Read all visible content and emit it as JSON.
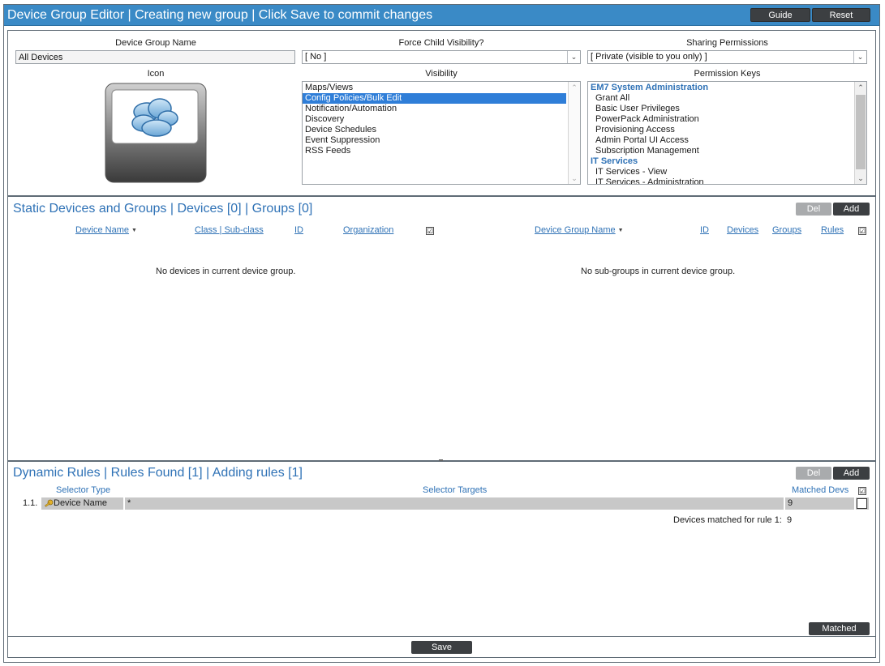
{
  "window": {
    "title": "Device Group Editor | Creating new group | Click Save to commit changes",
    "guide_label": "Guide",
    "reset_label": "Reset"
  },
  "top": {
    "name_label": "Device Group Name",
    "name_value": "All Devices",
    "force_label": "Force Child Visibility?",
    "force_value": "[ No ]",
    "sharing_label": "Sharing Permissions",
    "sharing_value": "[ Private (visible to you only) ]",
    "icon_label": "Icon",
    "visibility_label": "Visibility",
    "visibility_items": [
      "Maps/Views",
      "Config Policies/Bulk Edit",
      "Notification/Automation",
      "Discovery",
      "Device Schedules",
      "Event Suppression",
      "RSS Feeds"
    ],
    "visibility_selected": "Config Policies/Bulk Edit",
    "perm_label": "Permission Keys",
    "perm_groups": [
      {
        "name": "EM7 System Administration",
        "items": [
          "Grant All",
          "Basic User Privileges",
          "PowerPack Administration",
          "Provisioning Access",
          "Admin Portal UI Access",
          "Subscription Management"
        ]
      },
      {
        "name": "IT Services",
        "items": [
          "IT Services - View",
          "IT Services - Administration"
        ]
      }
    ]
  },
  "static": {
    "title": "Static Devices and Groups | Devices [0] | Groups [0]",
    "del_label": "Del",
    "add_label": "Add",
    "dev_cols": [
      "Device Name",
      "Class | Sub-class",
      "ID",
      "Organization"
    ],
    "grp_cols": [
      "Device Group Name",
      "ID",
      "Devices",
      "Groups",
      "Rules"
    ],
    "no_devices": "No devices in current device group.",
    "no_groups": "No sub-groups in current device group.",
    "check_mark": "☑"
  },
  "dynamic": {
    "title": "Dynamic Rules | Rules Found [1] | Adding rules [1]",
    "del_label": "Del",
    "add_label": "Add",
    "col_selector_type": "Selector Type",
    "col_selector_targets": "Selector Targets",
    "col_matched": "Matched Devs",
    "rule": {
      "index": "1.1.",
      "type": "Device Name",
      "target": "*",
      "matched": "9"
    },
    "matched_summary_label": "Devices matched for rule 1:",
    "matched_summary_value": "9",
    "matched_button": "Matched"
  },
  "footer": {
    "save_label": "Save"
  },
  "colors": {
    "title_bar": "#3a8ac6",
    "link_blue": "#2f72b6",
    "button_dark": "#3c3f42",
    "selected": "#2f7ed8"
  }
}
